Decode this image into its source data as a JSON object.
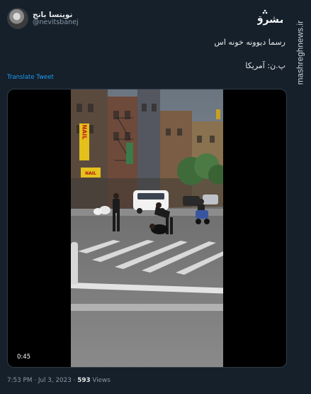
{
  "author": {
    "display_name": "نویتسا بانج",
    "handle": "@nevitsbanej"
  },
  "watermark": {
    "logo_text": "مشرق",
    "site_url": "mashreghnews.ir"
  },
  "tweet": {
    "line1": "رسما دیوونه خونه اس",
    "line2": "پ.ن: آمریکا",
    "translate_label": "Translate Tweet"
  },
  "video": {
    "duration": "0:45",
    "shop_sign_vertical": "NAIL",
    "shop_sign_small": "NAIL"
  },
  "meta": {
    "time": "7:53 PM",
    "separator": " · ",
    "date": "Jul 3, 2023",
    "views_count": "593",
    "views_label": " Views"
  },
  "colors": {
    "background": "#15202b",
    "link": "#1d9bf0",
    "muted": "#8b98a5",
    "text": "#e7e9ea"
  }
}
